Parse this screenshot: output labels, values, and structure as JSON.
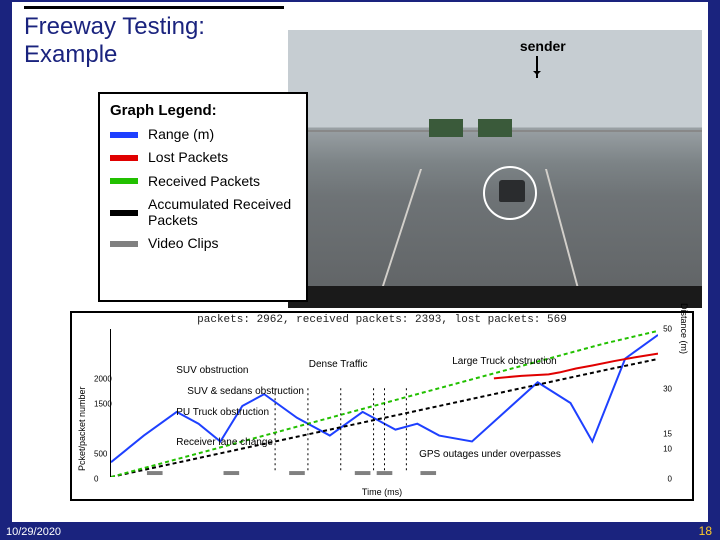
{
  "slide": {
    "title": "Freeway Testing: Example",
    "date": "10/29/2020",
    "page": "18"
  },
  "legend": {
    "title": "Graph Legend:",
    "items": [
      {
        "label": "Range (m)",
        "color": "#1e40ff"
      },
      {
        "label": "Lost Packets",
        "color": "#e00000"
      },
      {
        "label": "Received Packets",
        "color": "#22c000"
      },
      {
        "label": "Accumulated Received Packets",
        "color": "#000000"
      },
      {
        "label": "Video Clips",
        "color": "#808080"
      }
    ]
  },
  "photo": {
    "sender_label": "sender"
  },
  "chart_data": {
    "type": "line",
    "title": "packets: 2962, received packets: 2393, lost packets: 569",
    "xlabel": "Time (ms)",
    "ylabel": "Pcket/packet number",
    "y2label": "Distance (m)",
    "xlim": [
      0,
      100
    ],
    "ylim_left": [
      0,
      3000
    ],
    "ylim_right": [
      0,
      50
    ],
    "left_ticks": [
      0,
      500,
      1500,
      2000
    ],
    "right_ticks": [
      0,
      10,
      15,
      30,
      50
    ],
    "series": [
      {
        "name": "Range (m)",
        "color": "#1e40ff",
        "axis": "right",
        "x": [
          0,
          6,
          12,
          16,
          20,
          24,
          28,
          34,
          40,
          46,
          52,
          56,
          60,
          66,
          72,
          78,
          84,
          88,
          94,
          100
        ],
        "y": [
          5,
          14,
          22,
          18,
          12,
          24,
          28,
          20,
          14,
          22,
          16,
          18,
          14,
          12,
          22,
          32,
          25,
          12,
          40,
          48
        ]
      },
      {
        "name": "Accumulated Received Packets",
        "color": "#000000",
        "axis": "left",
        "dashed": true,
        "x": [
          0,
          10,
          20,
          30,
          40,
          50,
          60,
          70,
          80,
          90,
          100
        ],
        "y": [
          0,
          240,
          480,
          720,
          960,
          1200,
          1440,
          1680,
          1920,
          2160,
          2393
        ]
      },
      {
        "name": "Received Packets",
        "color": "#22c000",
        "axis": "left",
        "dashed": true,
        "x": [
          0,
          10,
          20,
          30,
          40,
          50,
          60,
          70,
          80,
          90,
          100
        ],
        "y": [
          0,
          300,
          600,
          900,
          1200,
          1500,
          1800,
          2100,
          2400,
          2700,
          2962
        ]
      },
      {
        "name": "Lost Packets",
        "color": "#e00000",
        "axis": "left",
        "x": [
          70,
          75,
          80,
          82,
          85,
          88,
          92,
          96,
          100
        ],
        "y": [
          2000,
          2050,
          2080,
          2120,
          2200,
          2260,
          2350,
          2430,
          2500
        ]
      }
    ],
    "annotations": [
      {
        "text": "SUV obstruction",
        "x": 12,
        "y_pct": 24
      },
      {
        "text": "Dense Traffic",
        "x": 36,
        "y_pct": 20
      },
      {
        "text": "Large Truck obstruction",
        "x": 62,
        "y_pct": 18
      },
      {
        "text": "SUV & sedans obstruction",
        "x": 14,
        "y_pct": 38
      },
      {
        "text": "PU Truck obstruction",
        "x": 12,
        "y_pct": 52
      },
      {
        "text": "Receiver lane change",
        "x": 12,
        "y_pct": 72
      },
      {
        "text": "GPS outages under overpasses",
        "x": 56,
        "y_pct": 80
      }
    ],
    "video_clip_bars_x": [
      8,
      22,
      34,
      46,
      50,
      58
    ]
  }
}
